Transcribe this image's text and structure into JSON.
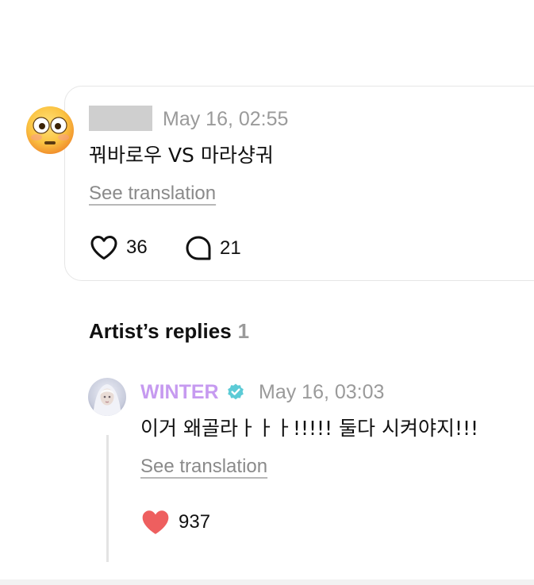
{
  "comment": {
    "avatar_icon": "flushed-face-emoji-icon",
    "author_hidden": true,
    "timestamp": "May 16, 02:55",
    "text": "꿔바로우 VS 마라샹궈",
    "see_translation": "See translation",
    "likes": "36",
    "replies": "21"
  },
  "artist_replies": {
    "heading": "Artist’s replies",
    "count": "1",
    "reply": {
      "name": "WINTER",
      "name_color": "#c69af0",
      "verified": true,
      "verified_color": "#5ccbd6",
      "timestamp": "May 16, 03:03",
      "text": "이거 왜골라ㅏㅏㅏ!!!!! 둘다 시켜야지!!!",
      "see_translation": "See translation",
      "likes": "937",
      "like_color": "#ee5f5f"
    }
  }
}
